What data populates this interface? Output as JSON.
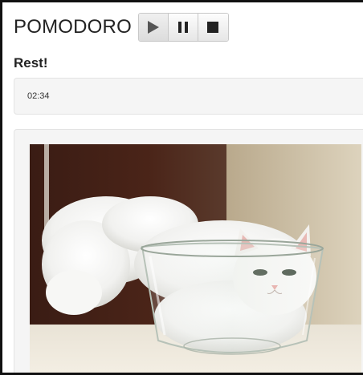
{
  "app": {
    "title": "POMODORO"
  },
  "controls": {
    "play_icon": "play-icon",
    "pause_icon": "pause-icon",
    "stop_icon": "stop-icon"
  },
  "status": {
    "text": "Rest!"
  },
  "timer": {
    "value": "02:34"
  },
  "image": {
    "subject": "white cat curled up in a glass bowl"
  },
  "colors": {
    "button_face": "#ececec",
    "icon": "#555555",
    "well": "#f5f5f5"
  }
}
